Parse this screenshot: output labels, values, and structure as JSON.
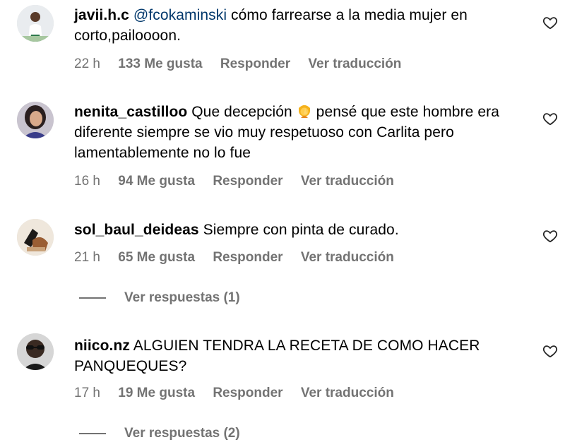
{
  "comments": [
    {
      "username": "javii.h.c",
      "mention": "@fcokaminski",
      "text": " cómo farrearse a la media mujer en corto,pailoooon.",
      "time": "22 h",
      "likes": "133 Me gusta",
      "reply": "Responder",
      "translate": "Ver traducción"
    },
    {
      "username": "nenita_castilloo",
      "text_before_emoji": " Que decepción ",
      "emoji": "facepalm-woman-emoji",
      "text_after_emoji": " pensé que este hombre era diferente siempre se vio muy respetuoso con Carlita pero lamentablemente no lo fue",
      "time": "16 h",
      "likes": "94 Me gusta",
      "reply": "Responder",
      "translate": "Ver traducción"
    },
    {
      "username": "sol_baul_deideas",
      "text": " Siempre con pinta de curado.",
      "time": "21 h",
      "likes": "65 Me gusta",
      "reply": "Responder",
      "translate": "Ver traducción",
      "view_replies": "Ver respuestas (1)"
    },
    {
      "username": "niico.nz",
      "text": " ALGUIEN TENDRA LA RECETA DE COMO HACER PANQUEQUES?",
      "time": "17 h",
      "likes": "19 Me gusta",
      "reply": "Responder",
      "translate": "Ver traducción",
      "view_replies": "Ver respuestas (2)"
    }
  ],
  "icons": {
    "like": "heart-outline-icon"
  },
  "colors": {
    "text": "#000000",
    "meta": "#737373",
    "mention": "#00376b",
    "background": "#ffffff"
  }
}
